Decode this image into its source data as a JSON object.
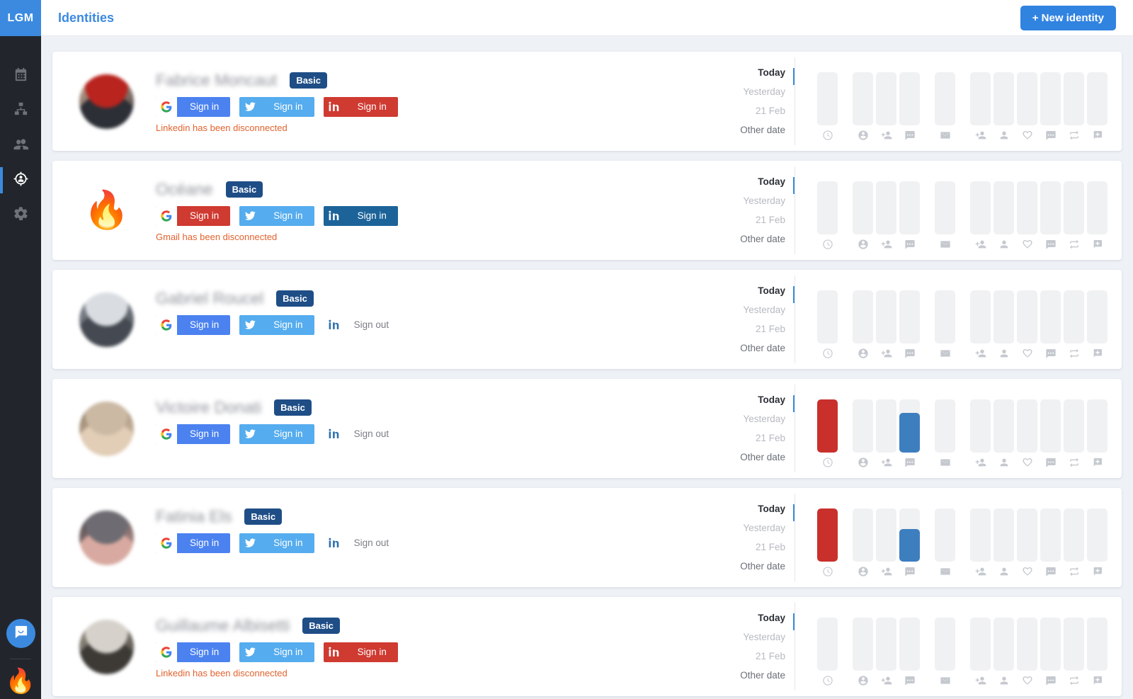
{
  "brand": {
    "logo": "LGM"
  },
  "sidebar": {
    "items": [
      {
        "name": "calendar",
        "icon": "calendar-icon",
        "active": false
      },
      {
        "name": "org-chart",
        "icon": "sitemap-icon",
        "active": false
      },
      {
        "name": "contacts",
        "icon": "people-icon",
        "active": false
      },
      {
        "name": "identities",
        "icon": "identity-target-icon",
        "active": true
      },
      {
        "name": "settings",
        "icon": "gear-icon",
        "active": false
      }
    ],
    "intercom_icon": "chat-bubble-icon",
    "user_avatar": "🔥"
  },
  "header": {
    "title": "Identities",
    "new_identity_label": "+ New identity"
  },
  "stats": {
    "date_labels": [
      "Today",
      "Yesterday",
      "21 Feb",
      "Other date"
    ],
    "icons": [
      "clock-icon",
      "account-circle-icon",
      "person-add-icon",
      "comment-icon",
      "email-icon",
      "person-add-icon",
      "person-icon",
      "heart-icon",
      "comment-icon",
      "repeat-icon",
      "plus-box-icon"
    ],
    "colors": {
      "red": "#c9302c",
      "blue": "#3d7ebf",
      "empty": "#f0f1f3"
    }
  },
  "buttons": {
    "sign_in": "Sign in",
    "sign_out": "Sign out",
    "badge_basic": "Basic"
  },
  "identities": [
    {
      "name": "Fabrice Moncaut",
      "badge": "Basic",
      "avatar_type": "photo",
      "avatar_colors": [
        "#b9241f",
        "#2c2f36",
        "#d8b39a"
      ],
      "google": "connected",
      "twitter": "connected",
      "linkedin": "error",
      "linkedin_mode": "button",
      "message": "Linkedin has been disconnected",
      "bars": [
        0,
        0,
        0,
        0,
        0,
        0,
        0,
        0,
        0,
        0,
        0
      ]
    },
    {
      "name": "Océane",
      "badge": "Basic",
      "avatar_type": "emoji",
      "avatar_emoji": "🔥",
      "google": "error",
      "twitter": "connected",
      "linkedin": "connected",
      "linkedin_mode": "button",
      "message": "Gmail has been disconnected",
      "bars": [
        0,
        0,
        0,
        0,
        0,
        0,
        0,
        0,
        0,
        0,
        0
      ]
    },
    {
      "name": "Gabriel Roucel",
      "badge": "Basic",
      "avatar_type": "photo",
      "avatar_colors": [
        "#d9dde2",
        "#454a52",
        "#8c9199"
      ],
      "google": "connected",
      "twitter": "connected",
      "linkedin": "signed-in",
      "linkedin_mode": "plain",
      "message": "",
      "bars": [
        0,
        0,
        0,
        0,
        0,
        0,
        0,
        0,
        0,
        0,
        0
      ]
    },
    {
      "name": "Victoire Donati",
      "badge": "Basic",
      "avatar_type": "photo",
      "avatar_colors": [
        "#cbb9a4",
        "#e2cdb6",
        "#8d7a66"
      ],
      "google": "connected",
      "twitter": "connected",
      "linkedin": "signed-in",
      "linkedin_mode": "plain",
      "message": "",
      "bars": [
        100,
        0,
        0,
        75,
        0,
        0,
        0,
        0,
        0,
        0,
        0
      ],
      "bar_colors": [
        "red",
        "",
        "",
        "blue",
        "",
        "",
        "",
        "",
        "",
        "",
        ""
      ]
    },
    {
      "name": "Fatinia Els",
      "badge": "Basic",
      "avatar_type": "photo",
      "avatar_colors": [
        "#6e6c72",
        "#d8a9a0",
        "#3b3c42"
      ],
      "google": "connected",
      "twitter": "connected",
      "linkedin": "signed-in",
      "linkedin_mode": "plain",
      "message": "",
      "bars": [
        100,
        0,
        0,
        62,
        0,
        0,
        0,
        0,
        0,
        0,
        0
      ],
      "bar_colors": [
        "red",
        "",
        "",
        "blue",
        "",
        "",
        "",
        "",
        "",
        "",
        ""
      ]
    },
    {
      "name": "Guillaume Albisetti",
      "badge": "Basic",
      "avatar_type": "photo",
      "avatar_colors": [
        "#d6d2cb",
        "#3d3a36",
        "#a39b90"
      ],
      "google": "connected",
      "twitter": "connected",
      "linkedin": "error",
      "linkedin_mode": "button",
      "message": "Linkedin has been disconnected",
      "bars": [
        0,
        0,
        0,
        0,
        0,
        0,
        0,
        0,
        0,
        0,
        0
      ]
    }
  ]
}
